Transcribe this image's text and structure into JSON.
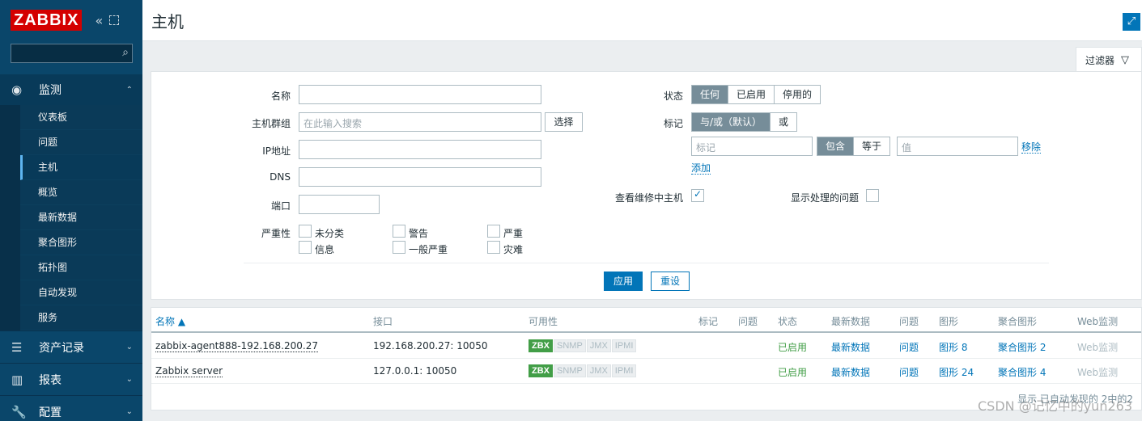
{
  "sidebar": {
    "logo": "ZABBIX",
    "collapse_icon": "«",
    "monitor": {
      "label": "监测",
      "items": [
        "仪表板",
        "问题",
        "主机",
        "概览",
        "最新数据",
        "聚合图形",
        "拓扑图",
        "自动发现",
        "服务"
      ]
    },
    "inventory": "资产记录",
    "reports": "报表",
    "config": "配置"
  },
  "header": {
    "title": "主机"
  },
  "filter": {
    "tab_label": "过滤器",
    "name_label": "名称",
    "hostgroup_label": "主机群组",
    "hostgroup_placeholder": "在此输入搜索",
    "select_button": "选择",
    "ip_label": "IP地址",
    "dns_label": "DNS",
    "port_label": "端口",
    "severity_label": "严重性",
    "severities": [
      "未分类",
      "警告",
      "严重",
      "信息",
      "一般严重",
      "灾难"
    ],
    "status_label": "状态",
    "status_options": [
      "任何",
      "已启用",
      "停用的"
    ],
    "tags_label": "标记",
    "tags_options": [
      "与/或（默认）",
      "或"
    ],
    "tag_placeholder": "标记",
    "tag_ops": [
      "包含",
      "等于"
    ],
    "value_placeholder": "值",
    "remove_link": "移除",
    "add_link": "添加",
    "maintenance_label": "查看维修中主机",
    "suppressed_label": "显示处理的问题",
    "apply_button": "应用",
    "reset_button": "重设"
  },
  "table": {
    "columns": [
      "名称 ▲",
      "接口",
      "可用性",
      "标记",
      "问题",
      "状态",
      "最新数据",
      "问题",
      "图形",
      "聚合图形",
      "Web监测"
    ],
    "rows": [
      {
        "name": "zabbix-agent888-192.168.200.27",
        "interface": "192.168.200.27: 10050",
        "status": "已启用",
        "latest": "最新数据",
        "problems": "问题",
        "graphs": "图形 8",
        "screens": "聚合图形 2",
        "web": "Web监测"
      },
      {
        "name": "Zabbix server",
        "interface": "127.0.0.1: 10050",
        "status": "已启用",
        "latest": "最新数据",
        "problems": "问题",
        "graphs": "图形 24",
        "screens": "聚合图形 4",
        "web": "Web监测"
      }
    ],
    "availability": [
      "ZBX",
      "SNMP",
      "JMX",
      "IPMI"
    ],
    "footer": "显示 已自动发现的 2中的2"
  },
  "watermark": "CSDN @记忆中的yun263",
  "colors": {
    "sidebar": "#0a466a",
    "logo": "#d40000",
    "accent": "#0275b8",
    "green": "#429e47"
  }
}
